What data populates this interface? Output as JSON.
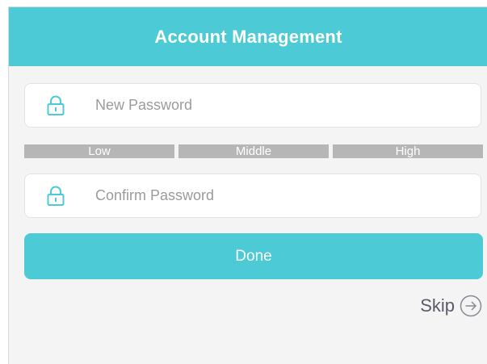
{
  "header": {
    "title": "Account Management"
  },
  "new_password": {
    "placeholder": "New Password",
    "icon": "lock-icon"
  },
  "strength_meter": {
    "levels": [
      "Low",
      "Middle",
      "High"
    ]
  },
  "confirm_password": {
    "placeholder": "Confirm Password",
    "icon": "lock-icon"
  },
  "actions": {
    "done_label": "Done",
    "skip_label": "Skip",
    "skip_icon": "arrow-right-circle-icon"
  },
  "colors": {
    "accent": "#4ccbd6",
    "meter": "#b6b6b6",
    "background": "#f4f4f4"
  }
}
